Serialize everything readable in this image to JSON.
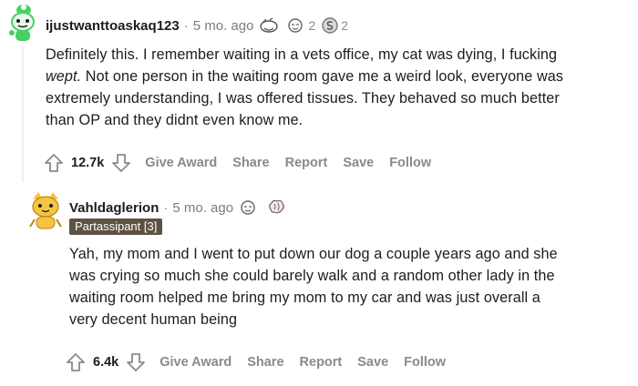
{
  "comments": [
    {
      "username": "ijustwanttoaskaq123",
      "separator": "·",
      "time": "5 mo. ago",
      "award_counts": [
        "2",
        "2"
      ],
      "body_lines": [
        "Definitely this. I remember waiting in a vets office, my cat was dying, I fucking",
        "wept. Not one person in the waiting room gave me a weird look, everyone was",
        "extremely understanding, I was offered tissues. They behaved so much better",
        "than OP and they didnt even know me."
      ],
      "score": "12.7k",
      "actions": [
        "Give Award",
        "Share",
        "Report",
        "Save",
        "Follow"
      ]
    },
    {
      "username": "Vahldaglerion",
      "separator": "·",
      "time": "5 mo. ago",
      "flair": "Partassipant [3]",
      "body_lines": [
        "Yah, my mom and I went to put down our dog a couple years ago and she",
        "was crying so much she could barely walk and a random other lady in the",
        "waiting room helped me bring my mom to my car and was just overall a",
        "very decent human being"
      ],
      "score": "6.4k",
      "actions": [
        "Give Award",
        "Share",
        "Report",
        "Save",
        "Follow"
      ]
    }
  ],
  "colors": {
    "text": "#1c1c1c",
    "muted": "#878a8c",
    "flair_bg": "#5e5243",
    "avatar1_green": "#46d160",
    "avatar2_yellow": "#f5c542"
  }
}
